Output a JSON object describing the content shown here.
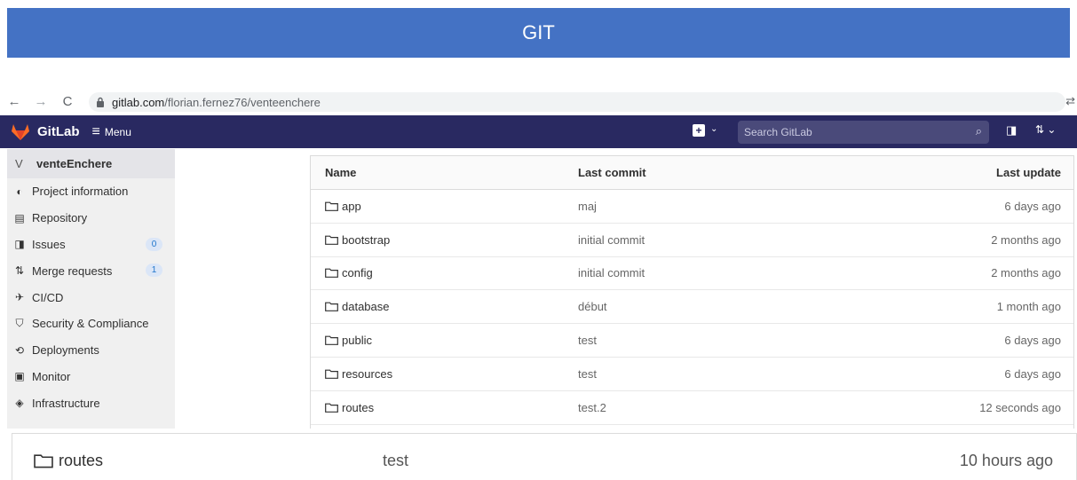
{
  "banner": {
    "title": "GIT"
  },
  "browser": {
    "url_host": "gitlab.com",
    "url_path": "/florian.fernez76/venteenchere",
    "back_icon": "←",
    "forward_icon": "→",
    "reload_icon": "C",
    "lock_icon": "lock-icon",
    "translate_icon": "translate-icon"
  },
  "topbar": {
    "brand": "GitLab",
    "menu_label": "Menu",
    "search_placeholder": "Search GitLab",
    "colors": {
      "background": "#292961",
      "logo": "#fc6d26"
    }
  },
  "sidebar": {
    "project_avatar": "V",
    "project_name": "venteEnchere",
    "items": [
      {
        "label": "Project information",
        "icon": "info-icon"
      },
      {
        "label": "Repository",
        "icon": "document-icon"
      },
      {
        "label": "Issues",
        "icon": "issues-icon",
        "count": "0"
      },
      {
        "label": "Merge requests",
        "icon": "merge-request-icon",
        "count": "1"
      },
      {
        "label": "CI/CD",
        "icon": "rocket-icon"
      },
      {
        "label": "Security & Compliance",
        "icon": "shield-icon"
      },
      {
        "label": "Deployments",
        "icon": "deployments-icon"
      },
      {
        "label": "Monitor",
        "icon": "monitor-icon"
      },
      {
        "label": "Infrastructure",
        "icon": "infrastructure-icon"
      }
    ]
  },
  "table": {
    "headers": {
      "name": "Name",
      "commit": "Last commit",
      "date": "Last update"
    },
    "rows": [
      {
        "name": "app",
        "commit": "maj",
        "date": "6 days ago"
      },
      {
        "name": "bootstrap",
        "commit": "initial commit",
        "date": "2 months ago"
      },
      {
        "name": "config",
        "commit": "initial commit",
        "date": "2 months ago"
      },
      {
        "name": "database",
        "commit": "début",
        "date": "1 month ago"
      },
      {
        "name": "public",
        "commit": "test",
        "date": "6 days ago"
      },
      {
        "name": "resources",
        "commit": "test",
        "date": "6 days ago"
      },
      {
        "name": "routes",
        "commit": "test.2",
        "date": "12 seconds ago"
      }
    ]
  },
  "zoomed_row": {
    "name": "routes",
    "commit": "test",
    "date": "10 hours ago"
  }
}
